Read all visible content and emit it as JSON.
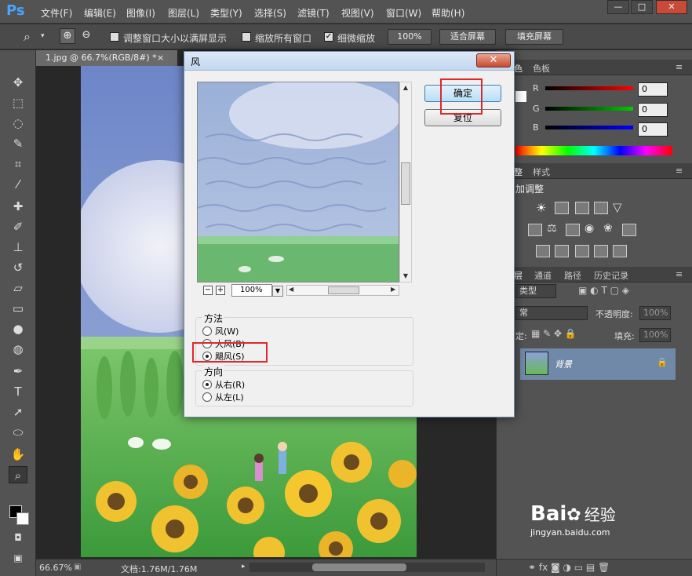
{
  "app": {
    "logo": "Ps",
    "menu": [
      "文件(F)",
      "编辑(E)",
      "图像(I)",
      "图层(L)",
      "类型(Y)",
      "选择(S)",
      "滤镜(T)",
      "视图(V)",
      "窗口(W)",
      "帮助(H)"
    ],
    "window_controls": [
      "—",
      "□",
      "✕"
    ]
  },
  "options_bar": {
    "resize_windows": "调整窗口大小以满屏显示",
    "zoom_all": "缩放所有窗口",
    "scrubby_zoom": "细微缩放",
    "zoom_value": "100%",
    "fit_screen": "适合屏幕",
    "fill_screen": "填充屏幕"
  },
  "document": {
    "tab_title": "1.jpg @ 66.7%(RGB/8#) *",
    "tab_close": "×",
    "status_zoom": "66.67%",
    "status_doc": "文档:1.76M/1.76M"
  },
  "dialog": {
    "title": "风",
    "close": "✕",
    "ok": "确定",
    "reset": "复位",
    "zoom_value": "100%",
    "zoom_minus": "−",
    "zoom_plus": "+",
    "method_title": "方法",
    "methods": [
      "风(W)",
      "大风(B)",
      "飓风(S)"
    ],
    "method_selected": 2,
    "direction_title": "方向",
    "directions": [
      "从右(R)",
      "从左(L)"
    ],
    "direction_selected": 0
  },
  "color_panel": {
    "tabs": [
      "色",
      "色板"
    ],
    "r_label": "R",
    "g_label": "G",
    "b_label": "B",
    "r": "0",
    "g": "0",
    "b": "0"
  },
  "adjust_panel": {
    "tabs": [
      "整",
      "样式"
    ],
    "title": "加调整"
  },
  "layers_panel": {
    "tabs": [
      "层",
      "通道",
      "路径",
      "历史记录"
    ],
    "kind": "类型",
    "blend_mode": "常",
    "opacity_label": "不透明度:",
    "opacity_value": "100%",
    "lock_label": "定:",
    "fill_label": "填充:",
    "fill_value": "100%",
    "layer_name": "背景"
  },
  "watermark": {
    "brand": "Bai",
    "suffix": "经验",
    "url": "jingyan.baidu.com"
  },
  "colors": {
    "accent_red": "#e0282a",
    "ps_blue": "#4aa3ff",
    "ok_button_blue": "#b9dff7"
  }
}
